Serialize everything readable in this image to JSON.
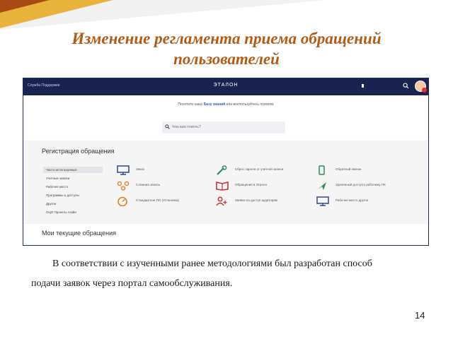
{
  "slide": {
    "title_line1": "Изменение регламента приема обращений",
    "title_line2": "пользователей",
    "body_line1": "В соответствии с изученными ранее методологиями был разработан способ",
    "body_line2": "подачи заявок через портал самообслуживания.",
    "page_number": "14",
    "accent_color": "#b35a14"
  },
  "portal": {
    "service_name": "Служба Поддержки",
    "brand": "ЭТАЛОН",
    "knowledge_prefix": "Посетите нашу",
    "knowledge_link": "Базу знаний",
    "knowledge_suffix": "или воспользуйтесь поиском",
    "search_placeholder": "Чем вам помочь?",
    "registration_title": "Регистрация обращения",
    "current_title": "Мои текущие обращения",
    "categories": [
      "Часто используемые",
      "Учетные записи",
      "Рабочее место",
      "Программы и доступы",
      "Другое",
      "ОЦО Проекты Агайн"
    ],
    "services": [
      {
        "label": "Заказ",
        "icon": "monitor-icon"
      },
      {
        "label": "Сброс пароля от учетной записи",
        "icon": "wrench-icon"
      },
      {
        "label": "Обратный звонок",
        "icon": "phone-icon"
      },
      {
        "label": "Сложная запись",
        "icon": "network-icon"
      },
      {
        "label": "Обращения в Эталон",
        "icon": "book-icon"
      },
      {
        "label": "Удаленный доступ к рабочему ПК",
        "icon": "plane-icon"
      },
      {
        "label": "Стандартное ПО (Установка)",
        "icon": "gauge-icon"
      },
      {
        "label": "Заявка на доступ аудиторам",
        "icon": "add-user-icon"
      },
      {
        "label": "Рабочее место другое",
        "icon": "display-icon"
      }
    ],
    "colors": {
      "topbar": "#1a2350",
      "link": "#2c62c8",
      "icon_blue": "#3b4f8a",
      "icon_orange": "#e07b1f",
      "icon_red": "#c8302e",
      "icon_green": "#2e8b57"
    }
  }
}
